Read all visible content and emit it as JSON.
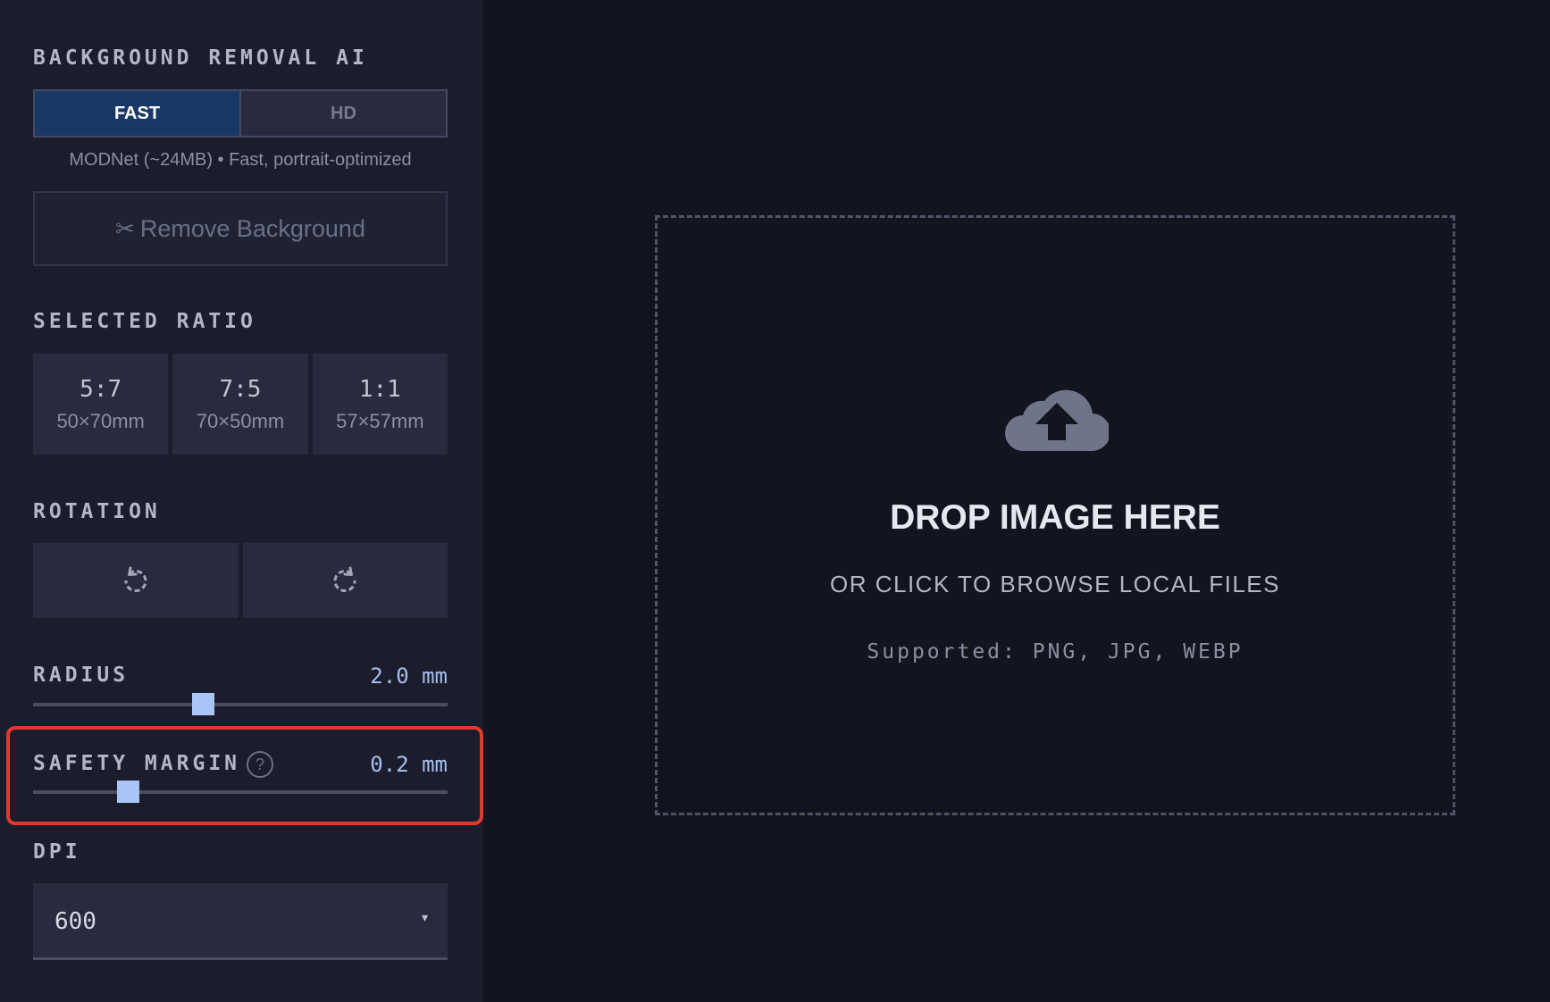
{
  "sidebar": {
    "bg_removal": {
      "heading": "BACKGROUND REMOVAL AI",
      "modes": [
        {
          "label": "FAST",
          "active": true
        },
        {
          "label": "HD",
          "active": false
        }
      ],
      "model_description": "MODNet (~24MB) • Fast, portrait-optimized",
      "remove_button": {
        "icon": "✂",
        "label": "Remove Background"
      }
    },
    "ratio": {
      "heading": "SELECTED RATIO",
      "options": [
        {
          "label": "5:7",
          "size": "50×70mm"
        },
        {
          "label": "7:5",
          "size": "70×50mm"
        },
        {
          "label": "1:1",
          "size": "57×57mm"
        }
      ]
    },
    "rotation": {
      "heading": "ROTATION",
      "buttons": [
        "rotate-left-icon",
        "rotate-right-icon"
      ]
    },
    "radius": {
      "heading": "RADIUS",
      "value": "2.0 mm",
      "fraction": 0.405
    },
    "safety_margin": {
      "heading": "SAFETY MARGIN",
      "help": "?",
      "value": "0.2 mm",
      "fraction": 0.215
    },
    "dpi": {
      "heading": "DPI",
      "value": "600",
      "caret": "▾"
    }
  },
  "drop_zone": {
    "icon": "cloud-upload-icon",
    "title": "DROP IMAGE HERE",
    "subtitle": "OR CLICK TO BROWSE LOCAL FILES",
    "supported": "Supported: PNG, JPG, WEBP"
  },
  "colors": {
    "accent": "#a9c4f6",
    "active_mode": "#183866",
    "highlight": "#e03a2f"
  }
}
